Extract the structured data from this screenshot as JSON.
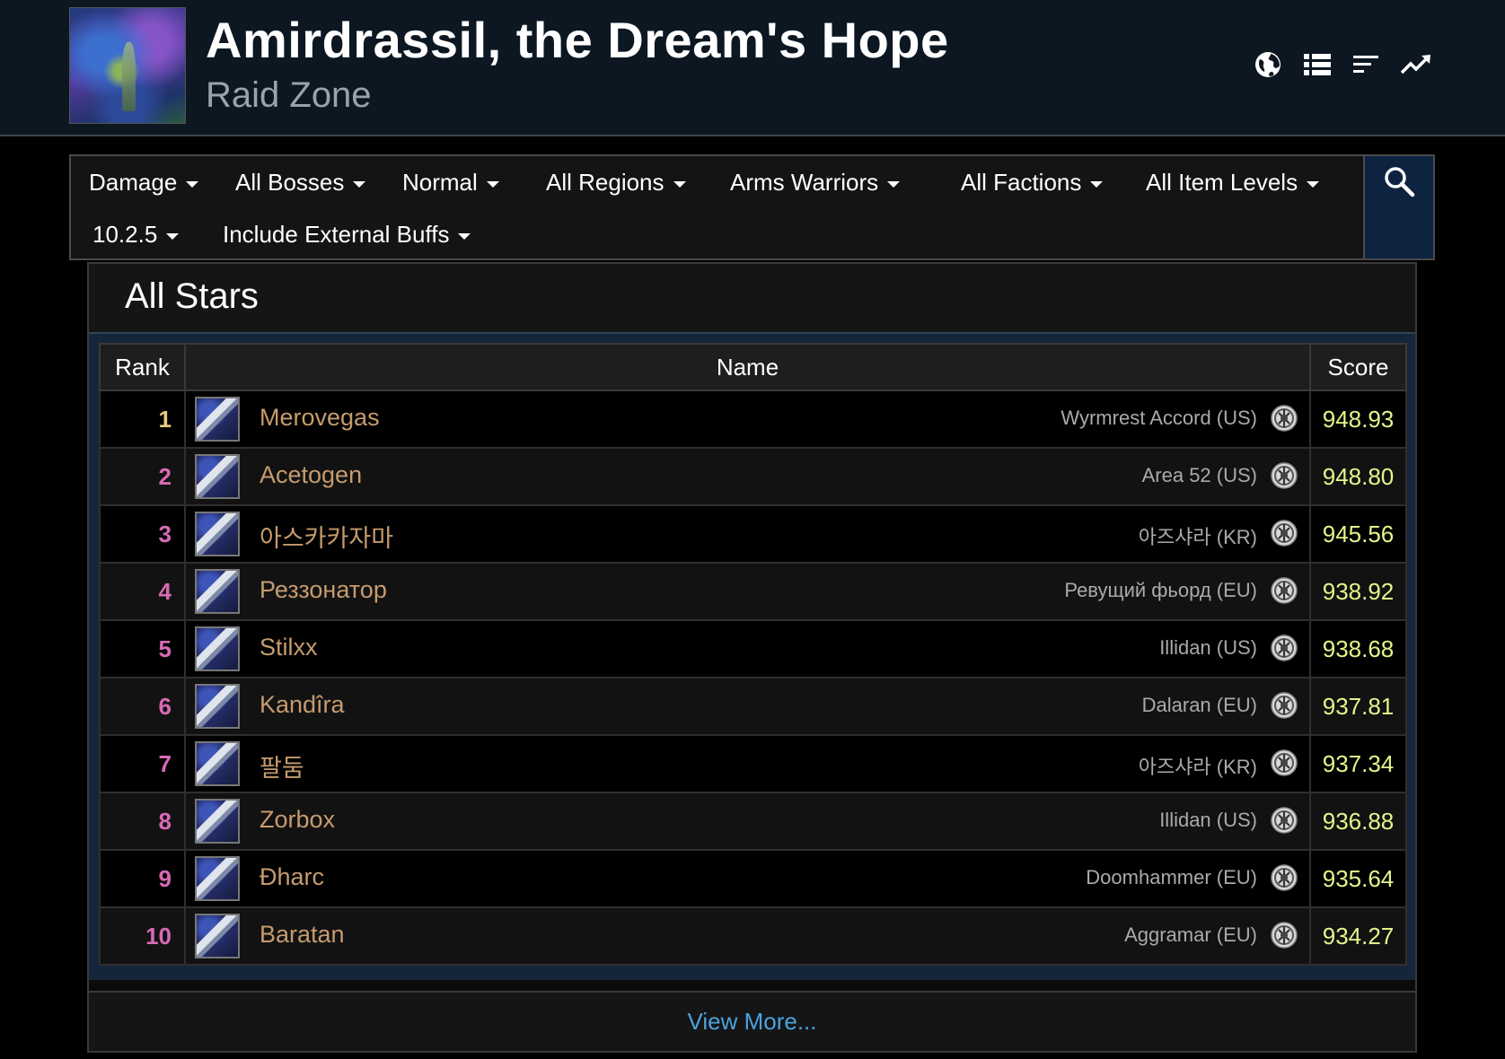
{
  "header": {
    "title": "Amirdrassil, the Dream's Hope",
    "subtitle": "Raid Zone",
    "icons": [
      "globe-icon",
      "list-icon",
      "sort-icon",
      "trend-icon"
    ]
  },
  "filters": {
    "metric": "Damage",
    "bosses": "All Bosses",
    "difficulty": "Normal",
    "regions": "All Regions",
    "spec": "Arms Warriors",
    "factions": "All Factions",
    "item_levels": "All Item Levels",
    "patch": "10.2.5",
    "buffs": "Include External Buffs"
  },
  "panel": {
    "title": "All Stars",
    "columns": {
      "rank": "Rank",
      "name": "Name",
      "score": "Score"
    },
    "view_more": "View More..."
  },
  "rows": [
    {
      "rank": "1",
      "name": "Merovegas",
      "server": "Wyrmrest Accord (US)",
      "score": "948.93"
    },
    {
      "rank": "2",
      "name": "Acetogen",
      "server": "Area 52 (US)",
      "score": "948.80"
    },
    {
      "rank": "3",
      "name": "아스카카자마",
      "server": "아즈샤라 (KR)",
      "score": "945.56"
    },
    {
      "rank": "4",
      "name": "Реззонатор",
      "server": "Ревущий фьорд (EU)",
      "score": "938.92"
    },
    {
      "rank": "5",
      "name": "Stilxx",
      "server": "Illidan (US)",
      "score": "938.68"
    },
    {
      "rank": "6",
      "name": "Kandîra",
      "server": "Dalaran (EU)",
      "score": "937.81"
    },
    {
      "rank": "7",
      "name": "팔둠",
      "server": "아즈샤라 (KR)",
      "score": "937.34"
    },
    {
      "rank": "8",
      "name": "Zorbox",
      "server": "Illidan (US)",
      "score": "936.88"
    },
    {
      "rank": "9",
      "name": "Ðharc",
      "server": "Doomhammer (EU)",
      "score": "935.64"
    },
    {
      "rank": "10",
      "name": "Baratan",
      "server": "Aggramar (EU)",
      "score": "934.27"
    }
  ],
  "colors": {
    "rank_first": "#e7cc80",
    "rank_other": "#d86ab5",
    "player_name": "#c69b6d",
    "score": "#e3f68a",
    "link": "#4aa3df"
  }
}
